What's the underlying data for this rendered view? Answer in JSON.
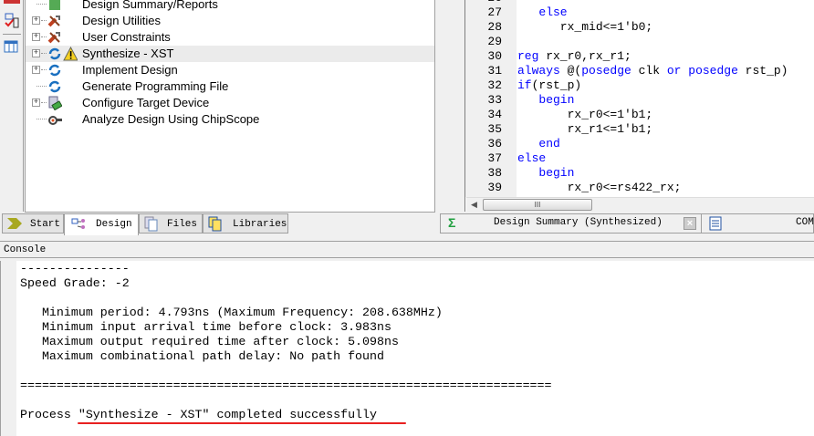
{
  "tree": {
    "items": [
      {
        "label": "Design Summary/Reports",
        "icon": "reports-icon",
        "expandable": false
      },
      {
        "label": "Design Utilities",
        "icon": "tools-icon",
        "expandable": true
      },
      {
        "label": "User Constraints",
        "icon": "tools-icon",
        "expandable": true
      },
      {
        "label": "Synthesize - XST",
        "icon": "process-warning-icon",
        "expandable": true,
        "selected": true
      },
      {
        "label": "Implement Design",
        "icon": "process-icon",
        "expandable": true
      },
      {
        "label": "Generate Programming File",
        "icon": "process-icon",
        "expandable": false
      },
      {
        "label": "Configure Target Device",
        "icon": "device-icon",
        "expandable": true
      },
      {
        "label": "Analyze Design Using ChipScope",
        "icon": "chipscope-icon",
        "expandable": false
      }
    ]
  },
  "left_tabs": [
    {
      "label": "Start",
      "icon": "start-icon"
    },
    {
      "label": "Design",
      "icon": "design-icon",
      "active": true
    },
    {
      "label": "Files",
      "icon": "files-icon"
    },
    {
      "label": "Libraries",
      "icon": "libraries-icon"
    }
  ],
  "editor": {
    "lines": [
      {
        "n": "27",
        "code": "   else",
        "kw": true
      },
      {
        "n": "28",
        "code": "      rx_mid<=1'b0;"
      },
      {
        "n": "29",
        "code": ""
      },
      {
        "n": "30",
        "code": "reg rx_r0,rx_r1;"
      },
      {
        "n": "31",
        "code": "always @(posedge clk or posedge rst_p)"
      },
      {
        "n": "32",
        "code": "if(rst_p)"
      },
      {
        "n": "33",
        "code": "   begin"
      },
      {
        "n": "34",
        "code": "       rx_r0<=1'b1;"
      },
      {
        "n": "35",
        "code": "       rx_r1<=1'b1;"
      },
      {
        "n": "36",
        "code": "   end"
      },
      {
        "n": "37",
        "code": "else"
      },
      {
        "n": "38",
        "code": "   begin"
      },
      {
        "n": "39",
        "code": "       rx_r0<=rs422_rx;"
      }
    ],
    "scroll_grip": "III"
  },
  "right_tabs": [
    {
      "label": "Design Summary (Synthesized)",
      "icon": "sigma-icon"
    },
    {
      "label": "COM",
      "icon": "document-icon"
    }
  ],
  "console": {
    "title": "Console",
    "lines": [
      "---------------",
      "Speed Grade: -2",
      "",
      "   Minimum period: 4.793ns (Maximum Frequency: 208.638MHz)",
      "   Minimum input arrival time before clock: 3.983ns",
      "   Maximum output required time after clock: 5.098ns",
      "   Maximum combinational path delay: No path found",
      "",
      "=========================================================================",
      "",
      "Process \"Synthesize - XST\" completed successfully"
    ]
  },
  "colors": {
    "keyword": "#0000ff",
    "underline": "#e82020"
  }
}
